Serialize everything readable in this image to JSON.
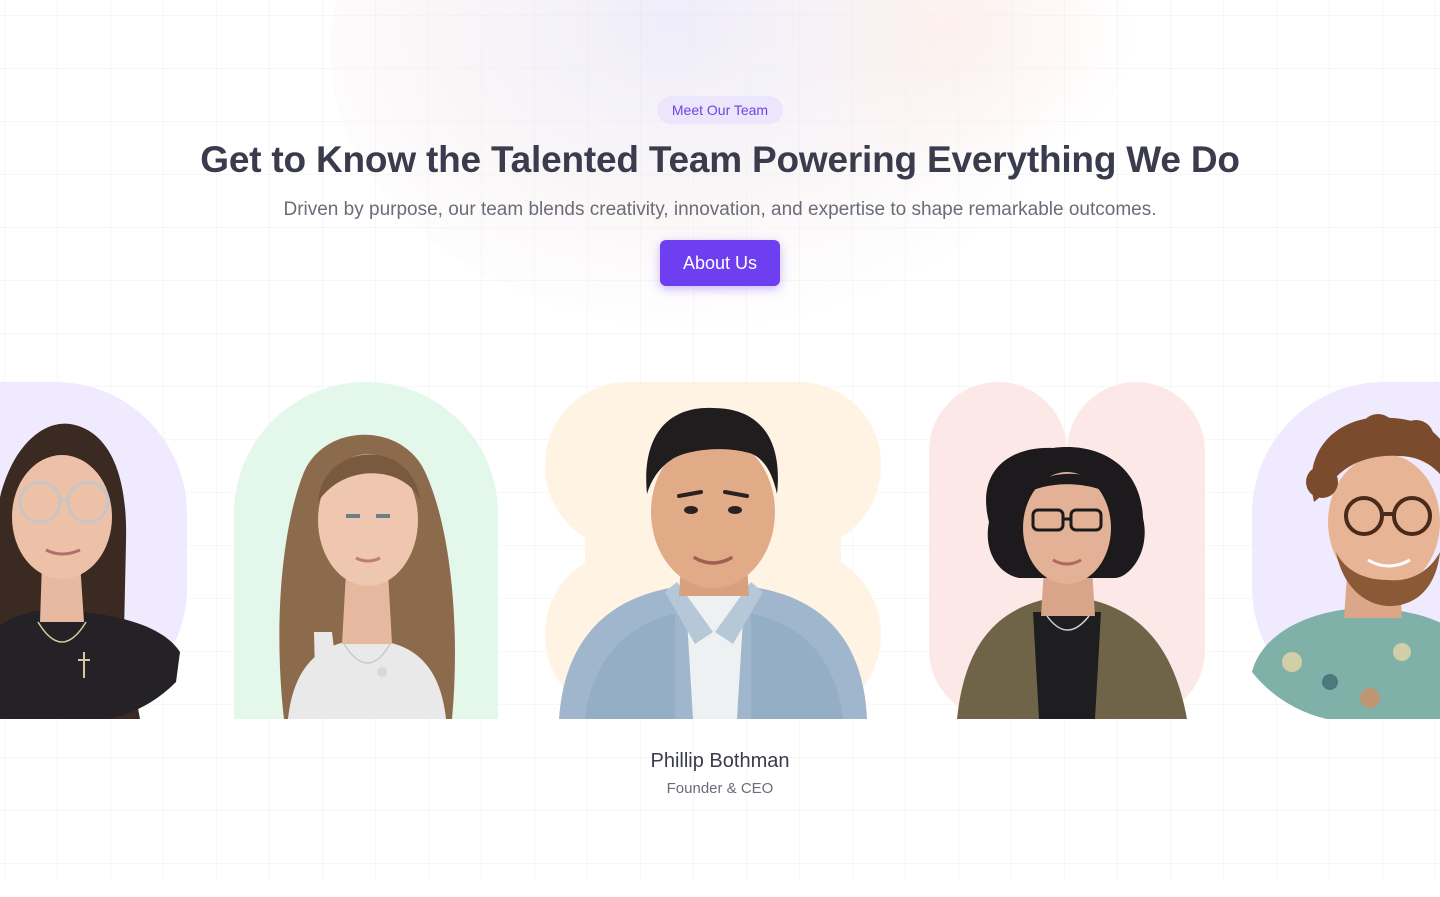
{
  "hero": {
    "badge": "Meet Our Team",
    "title": "Get to Know the Talented Team Powering Everything We Do",
    "subtitle": "Driven by purpose, our team blends creativity, innovation, and expertise to shape remarkable outcomes.",
    "cta_label": "About Us"
  },
  "featured_member": {
    "name": "Phillip Bothman",
    "role": "Founder & CEO"
  },
  "team_cards": [
    {
      "shape": "rounded-blob",
      "background_color": "#efeafd"
    },
    {
      "shape": "arch",
      "background_color": "#e3f7ea"
    },
    {
      "shape": "four-lobe",
      "background_color": "#fff4e4"
    },
    {
      "shape": "double-pill",
      "background_color": "#fde8e8"
    },
    {
      "shape": "rounded-blob",
      "background_color": "#efeafd"
    }
  ],
  "colors": {
    "accent": "#6d3ff0",
    "badge_background": "#ece6fc",
    "badge_text": "#6d43e0",
    "heading": "#3a3b4c",
    "body_text": "#6a6c78"
  }
}
